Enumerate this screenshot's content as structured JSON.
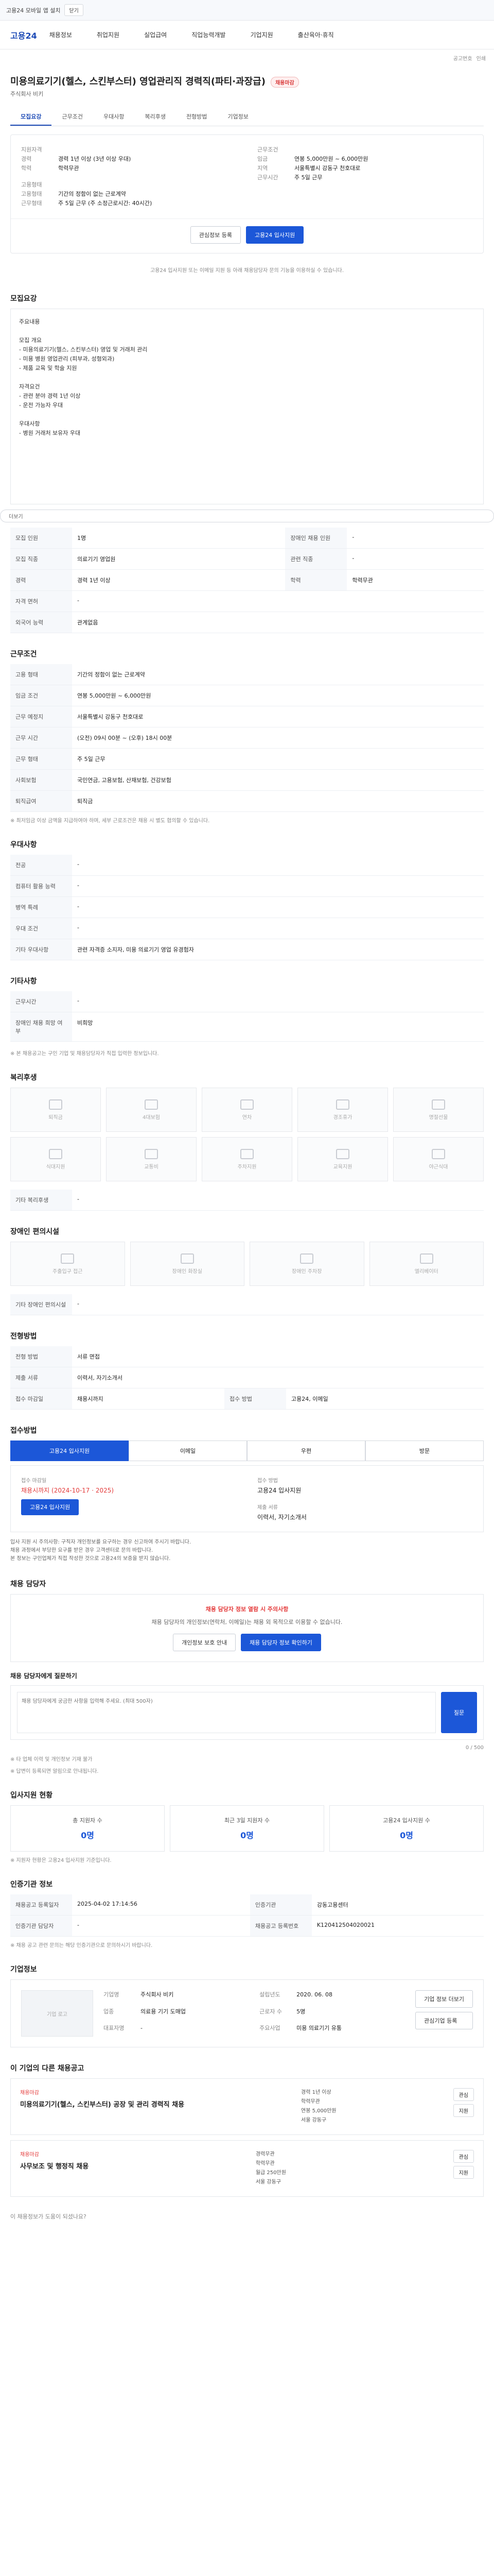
{
  "top": {
    "notice": "고용24 모바일 앱 설치",
    "btn": "닫기"
  },
  "header": {
    "logo": "고용24",
    "nav": [
      "채용정보",
      "취업지원",
      "실업급여",
      "직업능력개발",
      "기업지원",
      "출산육아·휴직"
    ],
    "crumb": [
      "공고번호",
      "인쇄"
    ]
  },
  "job": {
    "title": "미용의료기기(헬스, 스킨부스터) 영업관리직 경력직(파티·과장급)",
    "badge": "채용마감",
    "company": "주식회사 비키",
    "tabs": [
      "모집요강",
      "근무조건",
      "우대사항",
      "복리후생",
      "전형방법",
      "기업정보"
    ]
  },
  "summary": {
    "left": [
      {
        "k": "지원자격",
        "v": ""
      },
      {
        "k": "경력",
        "v": "경력 1년 이상 (3년 이상 우대)"
      },
      {
        "k": "학력",
        "v": "학력무관"
      },
      {
        "k": "고용형태",
        "v": ""
      },
      {
        "k": "고용형태",
        "v": "기간의 정함이 없는 근로계약"
      },
      {
        "k": "근무형태",
        "v": "주 5일 근무 (주 소정근로시간: 40시간)"
      }
    ],
    "right": [
      {
        "k": "근무조건",
        "v": ""
      },
      {
        "k": "임금",
        "v": "연봉 5,000만원 ~ 6,000만원"
      },
      {
        "k": "지역",
        "v": "서울특별시 강동구 천호대로"
      },
      {
        "k": "근무시간",
        "v": "주 5일 근무"
      }
    ],
    "btn_like": "관심정보 등록",
    "btn_apply": "고용24 입사지원",
    "notice": "고용24 입사지원 또는 이메일 지원 등 아래 채용담당자 문의 기능을 이용하실 수 있습니다."
  },
  "recruit": {
    "title": "모집요강",
    "detail_text": "주요내용\n\n모집 개요\n- 미용의료기기(헬스, 스킨부스터) 영업 및 거래처 관리\n- 미용 병원 영업관리 (피부과, 성형외과)\n- 제품 교육 및 학술 지원\n\n자격요건\n- 관련 분야 경력 1년 이상\n- 운전 가능자 우대\n\n우대사항\n- 병원 거래처 보유자 우대",
    "more": "더보기",
    "rows": [
      {
        "k": "모집 인원",
        "v": "1명",
        "k2": "장애인 채용 인원",
        "v2": "-"
      },
      {
        "k": "모집 직종",
        "v": "의료기기 영업원",
        "k2": "관련 직종",
        "v2": "-"
      },
      {
        "k": "경력",
        "v": "경력 1년 이상",
        "k2": "학력",
        "v2": "학력무관"
      },
      {
        "k": "자격 면허",
        "v": "-",
        "k2": "",
        "v2": ""
      },
      {
        "k": "외국어 능력",
        "v": "관계없음",
        "k2": "",
        "v2": ""
      }
    ]
  },
  "conditions": {
    "title": "근무조건",
    "rows": [
      {
        "k": "고용 형태",
        "v": "기간의 정함이 없는 근로계약"
      },
      {
        "k": "임금 조건",
        "v": "연봉 5,000만원 ~ 6,000만원"
      },
      {
        "k": "근무 예정지",
        "v": "서울특별시 강동구 천호대로"
      },
      {
        "k": "근무 시간",
        "v": "(오전) 09시 00분 ~ (오후) 18시 00분"
      },
      {
        "k": "근무 형태",
        "v": "주 5일 근무"
      },
      {
        "k": "사회보험",
        "v": "국민연금, 고용보험, 산재보험, 건강보험"
      },
      {
        "k": "퇴직급여",
        "v": "퇴직금"
      }
    ],
    "note": "※ 최저임금 이상 금액을 지급하여야 하며, 세부 근로조건은 채용 시 별도 협의할 수 있습니다."
  },
  "prefer": {
    "title": "우대사항",
    "rows": [
      {
        "k": "전공",
        "v": "-"
      },
      {
        "k": "컴퓨터 활용 능력",
        "v": "-"
      },
      {
        "k": "병역 특례",
        "v": "-"
      },
      {
        "k": "우대 조건",
        "v": "-"
      },
      {
        "k": "기타 우대사항",
        "v": "관련 자격증 소지자, 미용 의료기기 영업 유경험자"
      }
    ]
  },
  "etc": {
    "title": "기타사항",
    "rows": [
      {
        "k": "근무시간",
        "v": "-"
      },
      {
        "k": "장애인 채용 희망 여부",
        "v": "비희망"
      }
    ],
    "text": "※ 본 채용공고는 구인 기업 및 채용담당자가 직접 입력한 정보입니다."
  },
  "benefits": {
    "title": "복리후생",
    "items": [
      "퇴직금",
      "4대보험",
      "연차",
      "경조휴가",
      "명절선물",
      "식대지원",
      "교통비",
      "주차지원",
      "교육지원",
      "야근식대"
    ],
    "facility_title": "기타 복리후생",
    "facility_val": "-"
  },
  "disabled": {
    "title": "장애인 편의시설",
    "items": [
      "주출입구 접근",
      "장애인 화장실",
      "장애인 주차장",
      "엘리베이터"
    ],
    "title2": "기타 장애인 편의시설",
    "val2": "-"
  },
  "process": {
    "title": "전형방법",
    "rows": [
      {
        "k": "전형 방법",
        "v": "서류 면접",
        "k2": "",
        "v2": ""
      },
      {
        "k": "제출 서류",
        "v": "이력서, 자기소개서",
        "k2": "",
        "v2": ""
      },
      {
        "k": "접수 마감일",
        "v": "채용시까지",
        "k2": "접수 방법",
        "v2": "고용24, 이메일"
      }
    ]
  },
  "apply": {
    "title": "접수방법",
    "methods": [
      "고용24 입사지원",
      "이메일",
      "우편",
      "방문"
    ],
    "lbl_deadline": "접수 마감일",
    "deadline": "채용시까지 (2024-10-17 · 2025)",
    "lbl_method": "접수 방법",
    "method": "고용24 입사지원",
    "lbl_docs": "제출 서류",
    "docs": "이력서, 자기소개서",
    "btn": "고용24 입사지원",
    "warns": [
      "입사 지원 시 주의사항: 구직자 개인정보를 요구하는 경우 신고하여 주시기 바랍니다.",
      "채용 과정에서 부당한 요구를 받은 경우 고객센터로 문의 바랍니다.",
      "본 정보는 구인업체가 직접 작성한 것으로 고용24의 보증을 받지 않습니다."
    ]
  },
  "contact": {
    "title": "채용 담당자",
    "notice": "채용 담당자 정보 열람 시 주의사항",
    "desc": "채용 담당자의 개인정보(연락처, 이메일)는 채용 외 목적으로 이용할 수 없습니다.",
    "btn1": "개인정보 보호 안내",
    "btn2": "채용 담당자 정보 확인하기",
    "qa_title": "채용 담당자에게 질문하기",
    "qa_placeholder": "채용 담당자에게 궁금한 사항을 입력해 주세요. (최대 500자)",
    "qa_count": "0 / 500",
    "qa_btn": "질문",
    "qa_notes": [
      "※ 타 업체 이력 및 개인정보 기재 불가",
      "※ 답변이 등록되면 알림으로 안내됩니다."
    ]
  },
  "stats": {
    "title": "입사지원 현황",
    "items": [
      {
        "n": "0명",
        "l": "총 지원자 수"
      },
      {
        "n": "0명",
        "l": "최근 3일 지원자 수"
      },
      {
        "n": "0명",
        "l": "고용24 입사지원 수"
      }
    ],
    "note": "※ 지원자 현황은 고용24 입사지원 기준입니다."
  },
  "info": {
    "title": "인증기관 정보",
    "rows": [
      {
        "k": "채용공고 등록일자",
        "v": "2025-04-02 17:14:56",
        "k2": "인증기관",
        "v2": "강동고용센터"
      },
      {
        "k": "인증기관 담당자",
        "v": "-",
        "k2": "채용공고 등록번호",
        "v2": "K120412504020021"
      }
    ],
    "note": "※ 채용 공고 관련 문의는 해당 인증기관으로 문의하시기 바랍니다."
  },
  "company": {
    "title": "기업정보",
    "logo_text": "기업 로고",
    "rows": [
      {
        "k": "기업명",
        "v": "주식회사 비키"
      },
      {
        "k": "업종",
        "v": "의료용 기기 도매업"
      },
      {
        "k": "대표자명",
        "v": "-"
      },
      {
        "k": "설립년도",
        "v": "2020. 06. 08"
      },
      {
        "k": "근로자 수",
        "v": "5명"
      },
      {
        "k": "주요사업",
        "v": "미용 의료기기 유통"
      }
    ],
    "btn1": "기업 정보 더보기",
    "btn2": "관심기업 등록"
  },
  "others": {
    "title": "이 기업의 다른 채용공고",
    "items": [
      {
        "co": "채용마감",
        "tt": "미용의료기기(헬스, 스킨부스터) 공장 및 관리 경력직 채용",
        "m1": "경력 1년 이상",
        "m2": "학력무관",
        "m3": "연봉 5,000만원",
        "m4": "서울 강동구",
        "b1": "관심",
        "b2": "지원"
      },
      {
        "co": "채용마감",
        "tt": "사무보조 및 행정직 채용",
        "m1": "경력무관",
        "m2": "학력무관",
        "m3": "월급 250만원",
        "m4": "서울 강동구",
        "b1": "관심",
        "b2": "지원"
      }
    ]
  },
  "footer": {
    "text": "이 채용정보가 도움이 되셨나요?"
  }
}
